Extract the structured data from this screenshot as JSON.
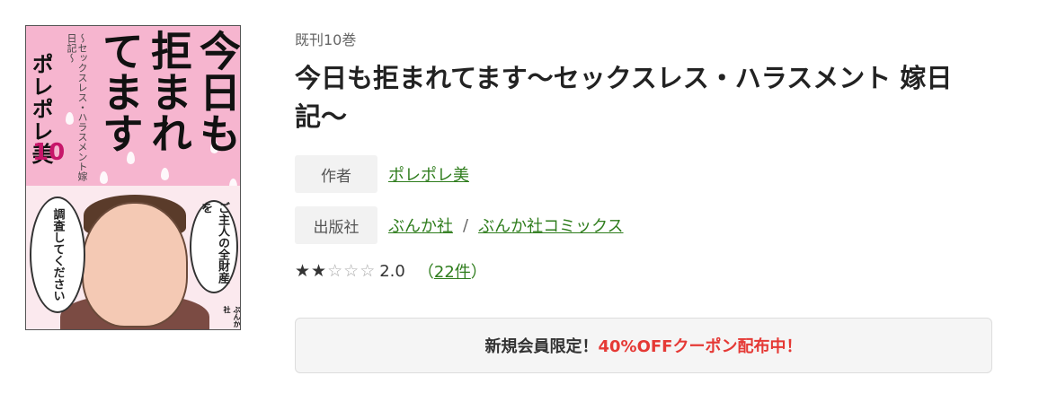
{
  "cover": {
    "title": "今日も拒まれてます",
    "subtitle": "〜セックスレス・ハラスメント嫁日記〜",
    "author": "ポレポレ美",
    "volume": "10",
    "bubble_left": "調査してください",
    "bubble_right": "ご主人の全財産を",
    "publisher": "ぶんか社"
  },
  "volume_label": "既刊10巻",
  "title": "今日も拒まれてます〜セックスレス・ハラスメント 嫁日記〜",
  "meta": {
    "author_tag": "作者",
    "author": "ポレポレ美",
    "publisher_tag": "出版社",
    "publisher": "ぶんか社",
    "separator": "/",
    "label": "ぶんか社コミックス"
  },
  "rating": {
    "value": "2.0",
    "score": 2,
    "max": 5,
    "open_paren": "（",
    "count": "22件",
    "close_paren": "）"
  },
  "coupon": {
    "text_a": "新規会員限定！",
    "text_b": "40%OFFクーポン配布中！"
  },
  "colors": {
    "link": "#2f7d1d",
    "coupon_accent": "#e53935",
    "cover_pink": "#f6b5cf"
  }
}
